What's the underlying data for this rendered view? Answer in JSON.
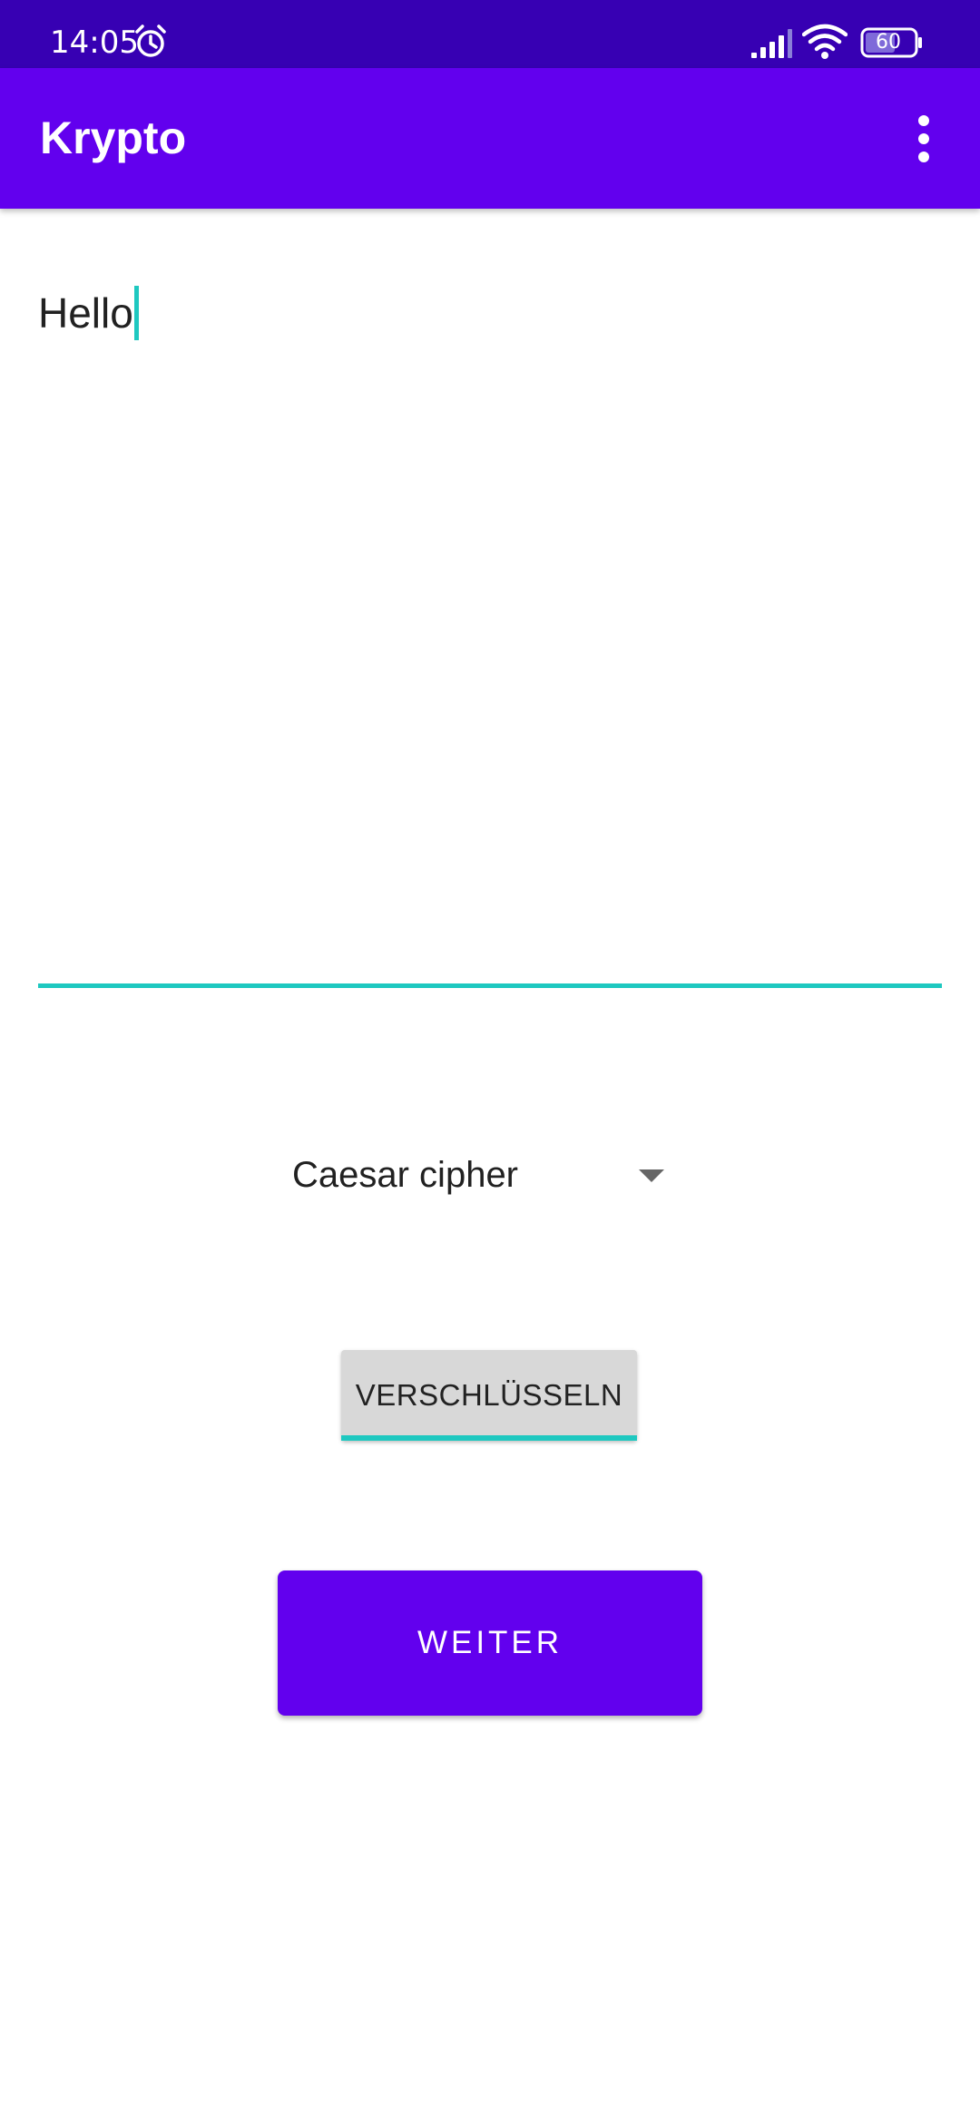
{
  "status_bar": {
    "time": "14:05",
    "battery_level": "60",
    "icons": [
      "alarm-icon",
      "signal-icon",
      "wifi-icon",
      "battery-icon"
    ]
  },
  "app_bar": {
    "title": "Krypto",
    "menu_icon": "overflow-menu-icon"
  },
  "text_input": {
    "value": "Hello"
  },
  "cipher_spinner": {
    "selected": "Caesar cipher",
    "icon": "dropdown-arrow-icon"
  },
  "encrypt_button": {
    "label": "VERSCHLÜSSELN"
  },
  "next_button": {
    "label": "WEITER"
  },
  "colors": {
    "status_bar": "#3700b3",
    "primary": "#6200ee",
    "accent": "#1ec8c0",
    "button_gray": "#d8d8d8"
  }
}
